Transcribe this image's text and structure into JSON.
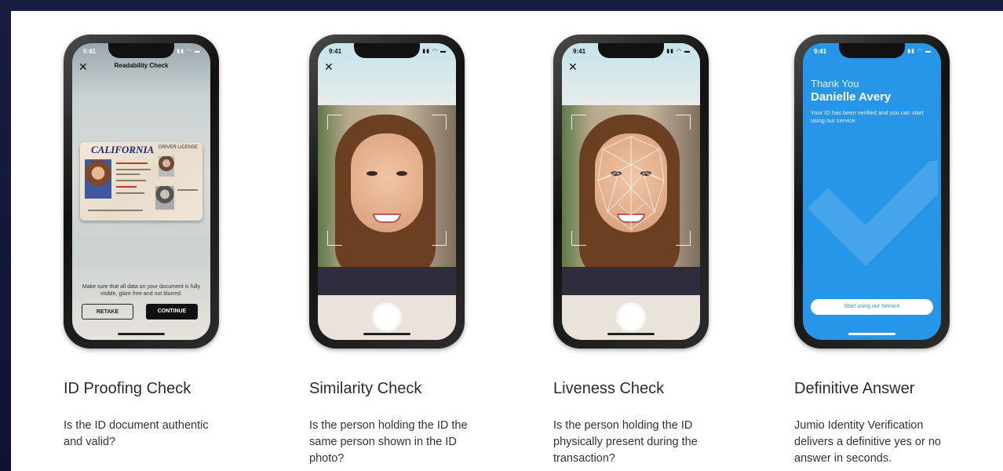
{
  "colors": {
    "background": "#121737",
    "panel": "#ffffff",
    "accent_blue": "#2796e8",
    "text": "#2b2b2b"
  },
  "status_bar": {
    "time": "9:41",
    "icons": "signal wifi battery"
  },
  "steps": [
    {
      "title": "ID Proofing Check",
      "description": "Is the ID document authentic and valid?",
      "screen": {
        "header": "Readability Check",
        "card": {
          "state": "CALIFORNIA",
          "type": "DRIVER LICENSE"
        },
        "message": "Make sure that all data on your document is fully visible, glare free and not blurred.",
        "retake_label": "RETAKE",
        "continue_label": "CONTINUE"
      }
    },
    {
      "title": "Similarity Check",
      "description": "Is the person holding the ID the same person shown in the ID photo?"
    },
    {
      "title": "Liveness Check",
      "description": "Is the person holding the ID physically present during the transaction?"
    },
    {
      "title": "Definitive Answer",
      "description": "Jumio Identity Verification delivers a definitive yes or no answer in seconds.",
      "screen": {
        "thank_you": "Thank You",
        "name": "Danielle Avery",
        "text": "Your ID has been verified and you can start using our service.",
        "cta_label": "Start using our Service"
      }
    }
  ]
}
